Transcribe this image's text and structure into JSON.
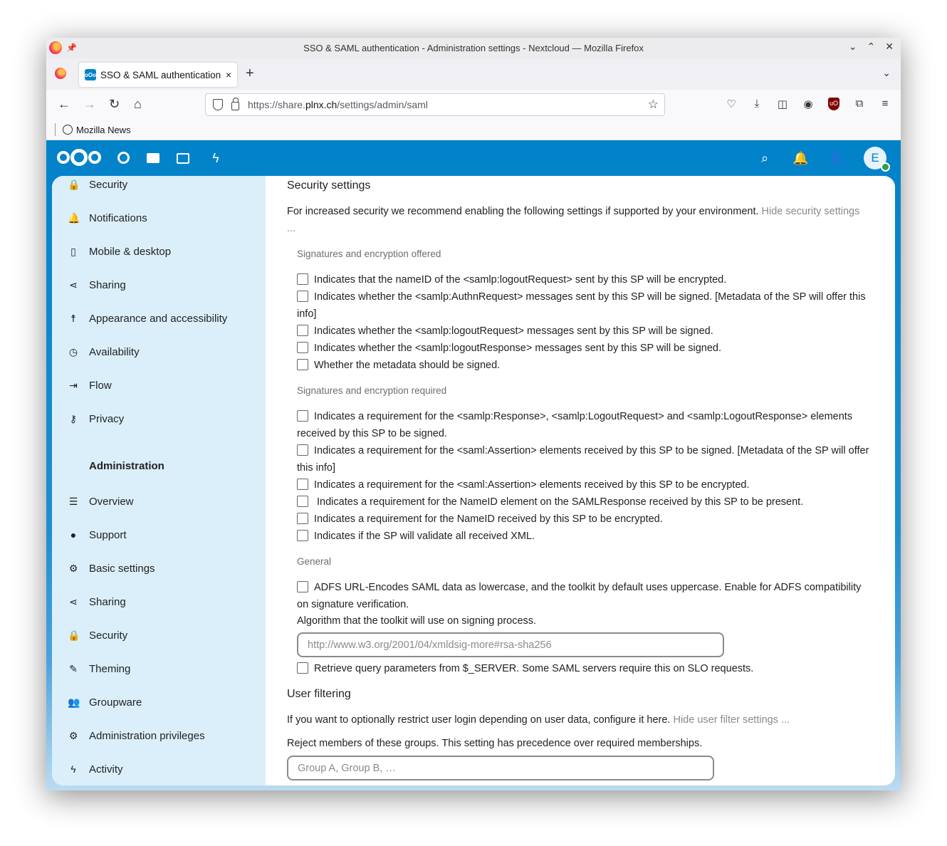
{
  "browser": {
    "window_title": "SSO & SAML authentication - Administration settings - Nextcloud — Mozilla Firefox",
    "tab_title": "SSO & SAML authentication",
    "tab_close": "×",
    "new_tab": "+",
    "url_prefix": "https://share.",
    "url_domain": "plnx.ch",
    "url_path": "/settings/admin/saml",
    "bookmark": "Mozilla News",
    "controls": {
      "minimize": "⌄",
      "maximize": "⌃",
      "close": "✕"
    }
  },
  "nextcloud": {
    "avatar_initial": "E",
    "sidebar": {
      "personal_items": [
        {
          "label": "Security",
          "icon": "lock-icon"
        },
        {
          "label": "Notifications",
          "icon": "bell-icon"
        },
        {
          "label": "Mobile & desktop",
          "icon": "phone-icon"
        },
        {
          "label": "Sharing",
          "icon": "share-icon"
        },
        {
          "label": "Appearance and accessibility",
          "icon": "accessibility-icon"
        },
        {
          "label": "Availability",
          "icon": "clock-icon"
        },
        {
          "label": "Flow",
          "icon": "flow-icon"
        },
        {
          "label": "Privacy",
          "icon": "key-icon"
        }
      ],
      "admin_heading": "Administration",
      "admin_items": [
        {
          "label": "Overview",
          "icon": "list-icon"
        },
        {
          "label": "Support",
          "icon": "chat-icon"
        },
        {
          "label": "Basic settings",
          "icon": "gear-icon"
        },
        {
          "label": "Sharing",
          "icon": "share-icon"
        },
        {
          "label": "Security",
          "icon": "lock-icon"
        },
        {
          "label": "Theming",
          "icon": "brush-icon"
        },
        {
          "label": "Groupware",
          "icon": "users-icon"
        },
        {
          "label": "Administration privileges",
          "icon": "cog-user-icon"
        },
        {
          "label": "Activity",
          "icon": "lightning-icon"
        }
      ]
    },
    "content": {
      "security_title": "Security settings",
      "security_desc": "For increased security we recommend enabling the following settings if supported by your environment.",
      "hide_security": "Hide security settings ...",
      "offered_heading": "Signatures and encryption offered",
      "offered": [
        "Indicates that the nameID of the <samlp:logoutRequest> sent by this SP will be encrypted.",
        "Indicates whether the <samlp:AuthnRequest> messages sent by this SP will be signed. [Metadata of the SP will offer this info]",
        "Indicates whether the <samlp:logoutRequest> messages sent by this SP will be signed.",
        "Indicates whether the <samlp:logoutResponse> messages sent by this SP will be signed.",
        "Whether the metadata should be signed."
      ],
      "required_heading": "Signatures and encryption required",
      "required": [
        "Indicates a requirement for the <samlp:Response>, <samlp:LogoutRequest> and <samlp:LogoutResponse> elements received by this SP to be signed.",
        "Indicates a requirement for the <saml:Assertion> elements received by this SP to be signed. [Metadata of the SP will offer this info]",
        "Indicates a requirement for the <saml:Assertion> elements received by this SP to be encrypted.",
        " Indicates a requirement for the NameID element on the SAMLResponse received by this SP to be present.",
        "Indicates a requirement for the NameID received by this SP to be encrypted.",
        "Indicates if the SP will validate all received XML."
      ],
      "general_heading": "General",
      "adfs": "ADFS URL-Encodes SAML data as lowercase, and the toolkit by default uses uppercase. Enable for ADFS compatibility on signature verification.",
      "algorithm_label": "Algorithm that the toolkit will use on signing process.",
      "algorithm_placeholder": "http://www.w3.org/2001/04/xmldsig-more#rsa-sha256",
      "retrieve": "Retrieve query parameters from $_SERVER. Some SAML servers require this on SLO requests.",
      "user_filtering_title": "User filtering",
      "user_filter_desc": "If you want to optionally restrict user login depending on user data, configure it here.",
      "hide_user_filter": "Hide user filter settings ...",
      "reject_label": "Reject members of these groups. This setting has precedence over required memberships.",
      "reject_placeholder": "Group A, Group B, …"
    }
  }
}
